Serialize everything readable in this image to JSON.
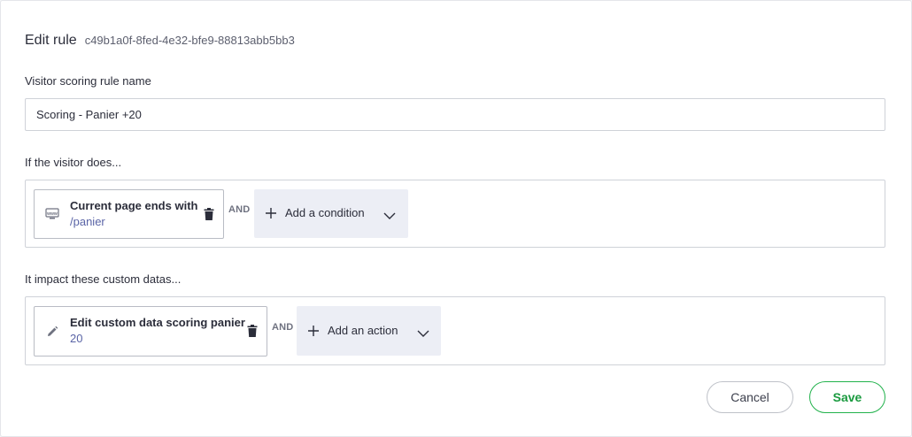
{
  "header": {
    "title": "Edit rule",
    "rule_id": "c49b1a0f-8fed-4e32-bfe9-88813abb5bb3"
  },
  "name_section": {
    "label": "Visitor scoring rule name",
    "value": "Scoring - Panier +20"
  },
  "conditions_section": {
    "label": "If the visitor does...",
    "condition": {
      "icon": "www-icon",
      "title": "Current page ends with",
      "value": "/panier"
    },
    "and_label": "AND",
    "add_button": {
      "label": "Add a condition"
    }
  },
  "actions_section": {
    "label": "It impact these custom datas...",
    "action": {
      "icon": "pencil-icon",
      "title": "Edit custom data scoring panier",
      "value": "20"
    },
    "and_label": "AND",
    "add_button": {
      "label": "Add an action"
    }
  },
  "footer": {
    "cancel_label": "Cancel",
    "save_label": "Save"
  },
  "colors": {
    "accent_green": "#22b24c",
    "value_blue": "#5a64a6",
    "add_button_bg": "#eceef5"
  }
}
